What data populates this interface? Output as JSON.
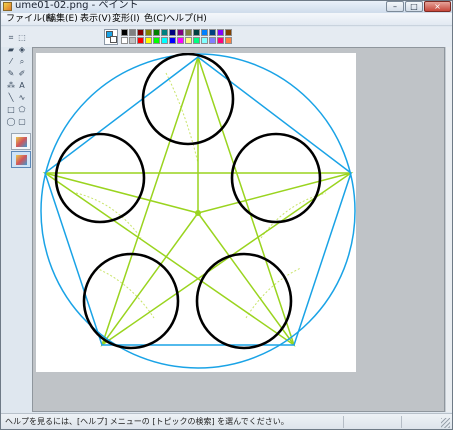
{
  "window": {
    "title": "ume01-02.png - ペイント",
    "minimize_glyph": "–",
    "maximize_glyph": "□",
    "close_glyph": "×"
  },
  "menu": {
    "items": [
      "ファイル(F)",
      "編集(E)",
      "表示(V)",
      "変形(I)",
      "色(C)",
      "ヘルプ(H)"
    ]
  },
  "palette": {
    "foreground": "#1aa3e6",
    "background": "#ffffff",
    "colors": [
      "#000000",
      "#808080",
      "#800000",
      "#808000",
      "#008000",
      "#008080",
      "#000080",
      "#800080",
      "#808040",
      "#004040",
      "#0080ff",
      "#004080",
      "#8000ff",
      "#804000",
      "#ffffff",
      "#c0c0c0",
      "#ff0000",
      "#ffff00",
      "#00ff00",
      "#00ffff",
      "#0000ff",
      "#ff00ff",
      "#ffff80",
      "#00ff80",
      "#80ffff",
      "#8080ff",
      "#ff0080",
      "#ff8040"
    ]
  },
  "tools": {
    "items": [
      "free-select-icon",
      "rect-select-icon",
      "eraser-icon",
      "fill-icon",
      "color-picker-icon",
      "magnifier-icon",
      "pencil-icon",
      "brush-icon",
      "airbrush-icon",
      "text-icon",
      "line-icon",
      "curve-icon",
      "rectangle-icon",
      "polygon-icon",
      "ellipse-icon",
      "rounded-rect-icon"
    ],
    "glyphs": [
      "⌗",
      "⬚",
      "▰",
      "◈",
      "⁄",
      "⌕",
      "✎",
      "✐",
      "⁂",
      "A",
      "╲",
      "∿",
      "□",
      "⬠",
      "◯",
      "▢"
    ]
  },
  "canvas": {
    "accent_blue": "#1aa3e6",
    "accent_green": "#9ad41f",
    "stroke_black": "#000000"
  },
  "status": {
    "text": "ヘルプを見るには、[ヘルプ] メニューの [トピックの検索] を選んでください。"
  }
}
